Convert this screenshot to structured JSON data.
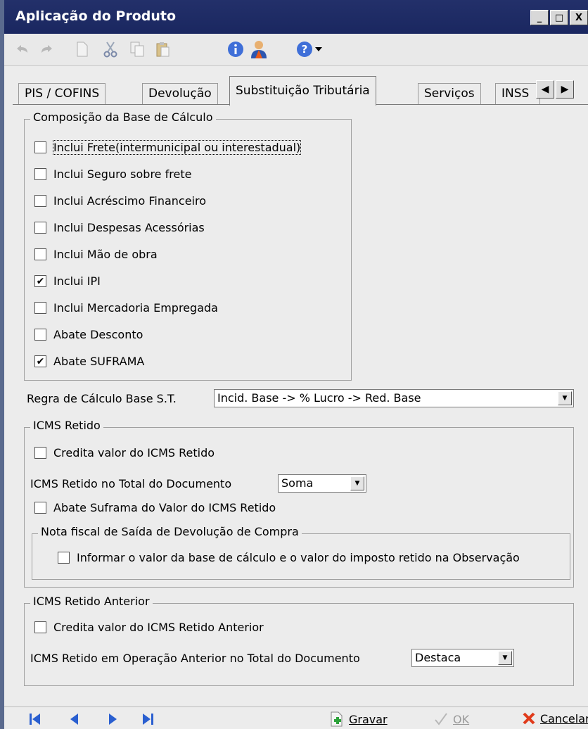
{
  "window": {
    "title": "Aplicação do Produto",
    "controls": [
      "_",
      "□",
      "X"
    ]
  },
  "tabs": [
    {
      "label": "PIS / COFINS",
      "active": false
    },
    {
      "label": "Devolução",
      "active": false
    },
    {
      "label": "Substituição Tributária",
      "active": true
    },
    {
      "label": "Serviços",
      "active": false
    },
    {
      "label": "INSS",
      "active": false
    }
  ],
  "base": {
    "legend": "Composição da Base de Cálculo",
    "items": [
      {
        "label": "Inclui Frete(intermunicipal ou interestadual)",
        "checked": false
      },
      {
        "label": "Inclui Seguro sobre frete",
        "checked": false
      },
      {
        "label": "Inclui Acréscimo Financeiro",
        "checked": false
      },
      {
        "label": "Inclui Despesas Acessórias",
        "checked": false
      },
      {
        "label": "Inclui Mão de obra",
        "checked": false
      },
      {
        "label": "Inclui IPI",
        "checked": true
      },
      {
        "label": "Inclui Mercadoria Empregada",
        "checked": false
      },
      {
        "label": "Abate Desconto",
        "checked": false
      },
      {
        "label": "Abate SUFRAMA",
        "checked": true
      }
    ]
  },
  "regra": {
    "label": "Regra de Cálculo Base S.T.",
    "value": "Incid. Base -> % Lucro -> Red. Base"
  },
  "icms_retido": {
    "legend": "ICMS Retido",
    "credita": {
      "label": "Credita valor do ICMS Retido",
      "checked": false
    },
    "total_label": "ICMS Retido no Total do Documento",
    "total_value": "Soma",
    "abate": {
      "label": "Abate Suframa do Valor do ICMS Retido",
      "checked": false
    },
    "nf": {
      "legend": "Nota fiscal de Saída de Devolução de Compra",
      "informar": {
        "label": "Informar o valor da base de cálculo e o valor do imposto retido na Observação",
        "checked": false
      }
    }
  },
  "icms_anterior": {
    "legend": "ICMS Retido Anterior",
    "credita": {
      "label": "Credita valor do ICMS Retido Anterior",
      "checked": false
    },
    "total_label": "ICMS Retido em Operação Anterior no Total do Documento",
    "total_value": "Destaca"
  },
  "footer": {
    "gravar": "Gravar",
    "ok": "OK",
    "cancelar": "Cancelar"
  },
  "icons": {
    "toolbar": [
      "undo-icon",
      "redo-icon",
      "new-doc-icon",
      "cut-icon",
      "copy-icon",
      "paste-icon",
      "info-icon",
      "user-icon",
      "help-icon",
      "dropdown-arrow-icon"
    ],
    "nav": [
      "first-record-icon",
      "previous-record-icon",
      "next-record-icon",
      "last-record-icon"
    ]
  },
  "check_glyph": "✔"
}
